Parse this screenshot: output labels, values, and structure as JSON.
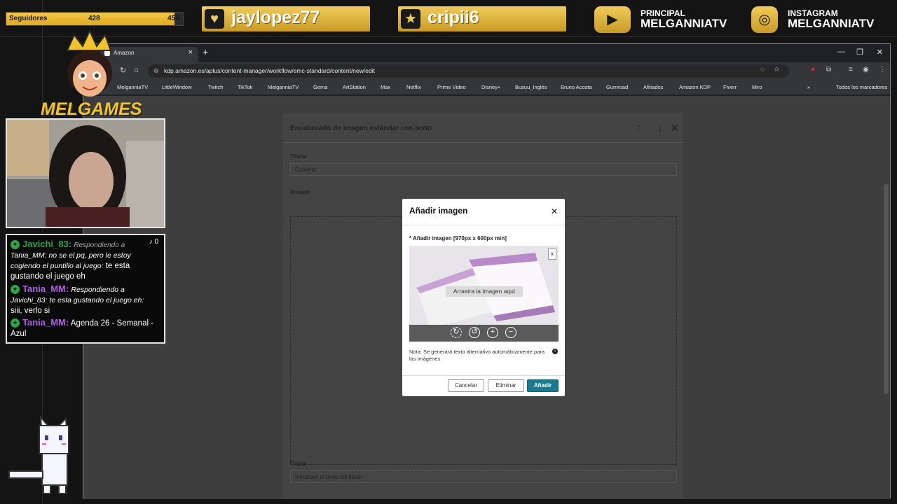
{
  "overlay": {
    "followers_label": "Seguidores",
    "followers_current": "428",
    "followers_goal": "450",
    "followers_progress": 0.951,
    "alert1_user": "jaylopez77",
    "alert2_user": "cripii6",
    "youtube_label": "PRINCIPAL",
    "youtube_name": "MELGANNIATV",
    "instagram_label": "INSTAGRAM",
    "instagram_name": "MELGANNIATV",
    "logo_text": "MELGAMES"
  },
  "chat": {
    "m1_user": "Javichi_83:",
    "m1_reply": "Respondiendo a",
    "m1_quote": "Tania_MM: no se el pq, pero le estoy cogiendo el puntillo al juego:",
    "m1_text": "te esta gustando el juego eh",
    "m2_user": "Tania_MM:",
    "m2_reply": "Respondiendo a Javichi_83: te esta gustando el juego eh:",
    "m2_text": "siii, verlo si",
    "m3_user": "Tania_MM:",
    "m3_text": "Agenda 26 - Semanal - Azul",
    "tiktok_count": "0"
  },
  "browser": {
    "tab_title": "Amazon",
    "url": "kdp.amazon.es/aplus/content-manager/workflow/emc-standard/content/new/edit",
    "bookmarks": [
      "MelganniaTV",
      "LittleWindow",
      "Twitch",
      "TikTok",
      "MelganniaTV",
      "Gema",
      "ArtStation",
      "Max",
      "Netflix",
      "Prime Video",
      "Disney+",
      "Busuu_Inglés",
      "Bruno Acosta",
      "Gumroad",
      "Afiliados",
      "Amazon KDP",
      "Fiverr",
      "Miro"
    ],
    "all_bookmarks": "Todos los marcadores"
  },
  "page": {
    "module_title": "Encabezado de imagen estándar con texto",
    "headline_label": "Titular",
    "headline_value": "Cubierta",
    "image_label": "Imagen",
    "headline2_label": "Titular",
    "headline2_placeholder": "Introducir el texto del titular"
  },
  "modal": {
    "title": "Añadir imagen",
    "required_label": "* Añadir imagen [970px x 600px min]",
    "drag_text": "Arrastra la imagen aquí",
    "note": "Nota: Se generará texto alternativo automáticamente para las imágenes",
    "cancel": "Cancelar",
    "remove": "Eliminar",
    "add": "Añadir"
  }
}
